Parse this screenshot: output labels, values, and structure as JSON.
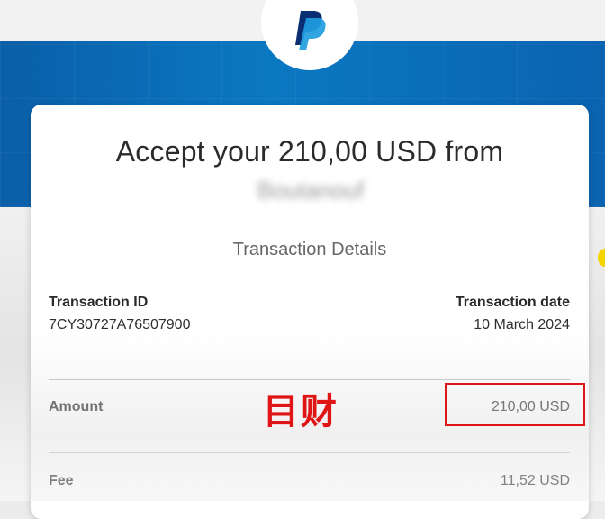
{
  "header": {
    "logo_icon": "paypal-logo-icon",
    "banner_color": "#0b78c2"
  },
  "card": {
    "title": "Accept your 210,00 USD from",
    "sender": "Boutanouf",
    "section_title": "Transaction Details"
  },
  "details": {
    "transaction_id_label": "Transaction ID",
    "transaction_id_value": "7CY30727A76507900",
    "transaction_date_label": "Transaction date",
    "transaction_date_value": "10 March 2024",
    "amount_label": "Amount",
    "amount_value": "210,00 USD",
    "fee_label": "Fee",
    "fee_value": "11,52 USD"
  },
  "annotation": {
    "text": "目财",
    "color": "#e01616"
  }
}
